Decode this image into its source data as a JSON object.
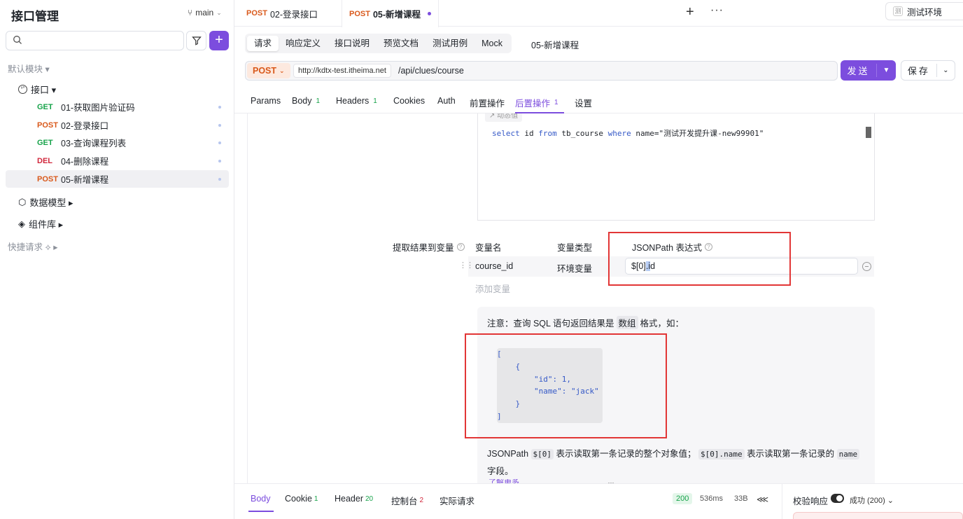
{
  "sidebar": {
    "title": "接口管理",
    "branch": "main",
    "search_placeholder": "",
    "default_module": "默认模块 ▾",
    "group_interfaces": "接口 ▾",
    "items": [
      {
        "method": "GET",
        "name": "01-获取图片验证码"
      },
      {
        "method": "POST",
        "name": "02-登录接口"
      },
      {
        "method": "GET",
        "name": "03-查询课程列表"
      },
      {
        "method": "DEL",
        "name": "04-删除课程"
      },
      {
        "method": "POST",
        "name": "05-新增课程"
      }
    ],
    "data_model": "数据模型 ▸",
    "components": "组件库 ▸",
    "quick_requests": "快捷请求 ⟡ ▸"
  },
  "tabs": [
    {
      "method": "POST",
      "name": "02-登录接口"
    },
    {
      "method": "POST",
      "name": "05-新增课程"
    }
  ],
  "env": {
    "badge": "测",
    "name": "测试环境"
  },
  "subtabs": [
    "请求",
    "响应定义",
    "接口说明",
    "预览文档",
    "测试用例",
    "Mock"
  ],
  "request_name": "05-新增课程",
  "url": {
    "method": "POST",
    "base": "http://kdtx-test.itheima.net",
    "path": "/api/clues/course"
  },
  "buttons": {
    "send": "发送",
    "save": "保存"
  },
  "param_tabs": {
    "params": "Params",
    "body": "Body",
    "body_count": "1",
    "headers": "Headers",
    "headers_count": "1",
    "cookies": "Cookies",
    "auth": "Auth",
    "pre": "前置操作",
    "post": "后置操作",
    "post_count": "1",
    "settings": "设置"
  },
  "sql": {
    "tag": "↗ 动态值",
    "kw_select": "select",
    "f_id": " id ",
    "kw_from": "from",
    "f_table": " tb_course ",
    "kw_where": "where",
    "f_cond": " name=\"测试开发提升课-new99901\""
  },
  "extract": {
    "label": "提取结果到变量",
    "col_name": "变量名",
    "col_type": "变量类型",
    "col_jsonpath": "JSONPath 表达式",
    "var_name": "course_id",
    "var_type": "环境变量",
    "jsonpath_a": "$[0]",
    "jsonpath_sel": ".i",
    "jsonpath_b": "d",
    "add_var": "添加变量"
  },
  "note": {
    "prefix": "注意：查询 SQL 语句返回结果是",
    "highlight": "数组",
    "suffix": "格式，如：",
    "code": [
      "[",
      "    {",
      "        \"id\": 1,",
      "        \"name\": \"jack\"",
      "    }",
      "]"
    ],
    "desc_1": "JSONPath",
    "desc_code1": "$[0]",
    "desc_2": "表示读取第一条记录的整个对象值；",
    "desc_code2": "$[0].name",
    "desc_3": "表示读取第一条记录的",
    "desc_code3": "name",
    "desc_4": "字段。",
    "learn_more": "了解更多",
    "ellipsis": "···"
  },
  "bottom": {
    "body": "Body",
    "cookie": "Cookie",
    "cookie_count": "1",
    "header": "Header",
    "header_count": "20",
    "console": "控制台",
    "console_count": "2",
    "actual": "实际请求",
    "status": "200",
    "time": "536ms",
    "size": "33B",
    "verify": "校验响应",
    "result": "成功 (200) ⌄"
  },
  "colors": {
    "accent": "#7c4dde",
    "post": "#d9591b",
    "get": "#17a34a",
    "del": "#d1263b",
    "highlight_box": "#e23636"
  }
}
